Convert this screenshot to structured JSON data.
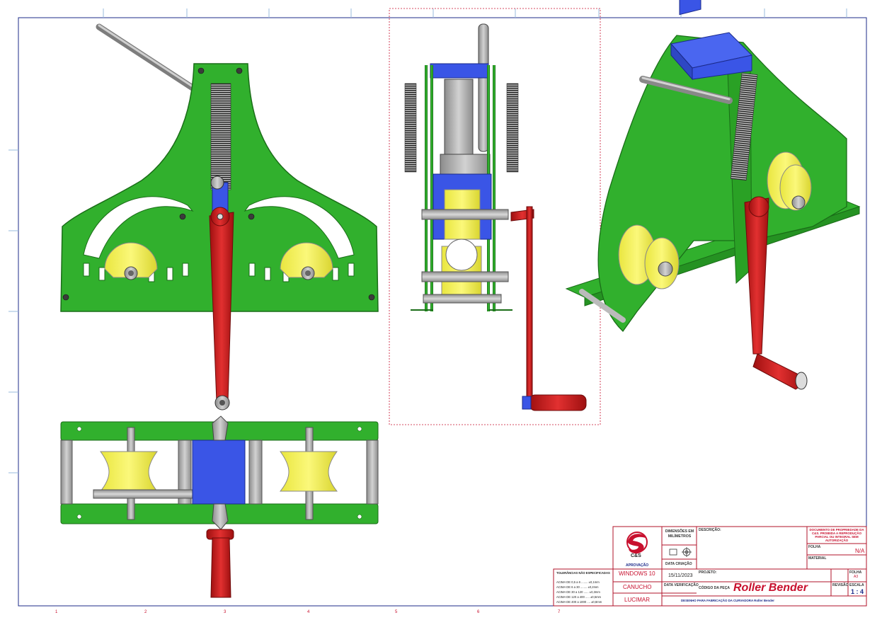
{
  "frame": {
    "zones": [
      "1",
      "2",
      "3",
      "4",
      "5",
      "6",
      "7"
    ],
    "colors": {
      "border": "#1c2b8a",
      "title_block": "#b0132a",
      "frame_green": "#31b02d",
      "roller_yellow": "#f2ef52",
      "block_blue": "#3a55e6",
      "lever_red": "#c81b1b",
      "shaft_gray": "#a9a9a9"
    }
  },
  "title_block": {
    "logo": "C&S",
    "approval_label": "APROVAÇÃO",
    "dimensions_label": "DIMENSÕES EM MILÍMETROS",
    "description_label": "DESCRIÇÃO:",
    "creation_date_label": "DATA CRIAÇÃO",
    "creation_date": "15/11/2023",
    "verification_date_label": "DATA VERIFICAÇÃO",
    "project_label": "PROJETO:",
    "part_code_label": "CÓDIGO DA PEÇA",
    "part_name": "Roller Bender",
    "revision_label": "REVISÃO",
    "scale_label": "ESCALA",
    "scale": "1 : 4",
    "size_label": "FOLHA",
    "size": "A3",
    "material_label": "MATERIAL",
    "na_value": "N/A",
    "project_value": "WINDOWS 10",
    "checker_value": "CANUCHO",
    "approver_value": "LUCIMAR",
    "tolerance_title": "TOLERÂNCIAS NÃO ESPECIFICADAS",
    "tolerance_rows": [
      "ACIMA DE 0,5 a 6 ........ ±0,1mm",
      "ACIMA DE 6 a 30 ........ ±0,2mm",
      "ACIMA DE 30 a 120 ...... ±0,3mm",
      "ACIMA DE 120 a 400 ..... ±0,5mm",
      "ACIMA DE 400 a 1000 .... ±0,8mm"
    ],
    "ownership_note": "DOCUMENTO DE PROPRIEDADE DA C&S. PROIBIDA A REPRODUÇÃO PARCIAL OU INTEGRAL SEM AUTORIZAÇÃO",
    "footer_note": "DESENHO PARA FABRICAÇÃO DA CURVADORA Roller Bender"
  }
}
